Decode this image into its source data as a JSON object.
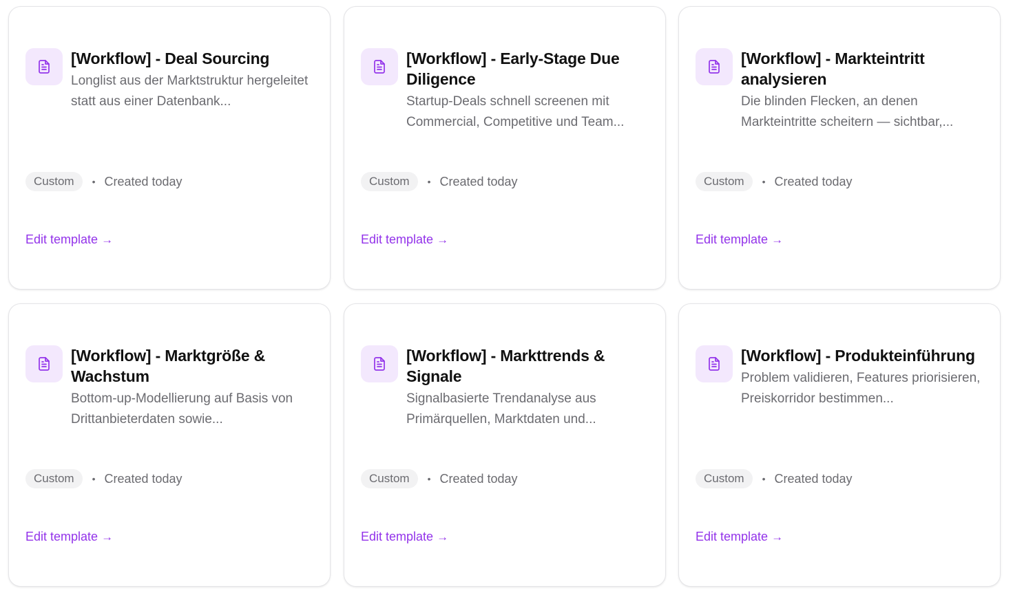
{
  "colors": {
    "accent": "#9333ea",
    "icon_bg": "#f3e8fd",
    "badge_bg": "#f2f2f3",
    "text_muted": "#6b6b70"
  },
  "cards": [
    {
      "icon": "document-icon",
      "title": "[Workflow] - Deal Sourcing",
      "description": "Longlist aus der Marktstruktur hergeleitet statt aus einer Datenbank...",
      "badge": "Custom",
      "separator": "•",
      "created": "Created today",
      "link_label": "Edit template",
      "link_arrow": "→"
    },
    {
      "icon": "document-icon",
      "title": "[Workflow] - Early-Stage Due Diligence",
      "description": "Startup-Deals schnell screenen mit Commercial, Competitive und Team...",
      "badge": "Custom",
      "separator": "•",
      "created": "Created today",
      "link_label": "Edit template",
      "link_arrow": "→"
    },
    {
      "icon": "document-icon",
      "title": "[Workflow] - Markteintritt analysieren",
      "description": "Die blinden Flecken, an denen Markteintritte scheitern — sichtbar,...",
      "badge": "Custom",
      "separator": "•",
      "created": "Created today",
      "link_label": "Edit template",
      "link_arrow": "→"
    },
    {
      "icon": "document-icon",
      "title": "[Workflow] - Marktgröße & Wachstum",
      "description": "Bottom-up-Modellierung auf Basis von Drittanbieterdaten sowie...",
      "badge": "Custom",
      "separator": "•",
      "created": "Created today",
      "link_label": "Edit template",
      "link_arrow": "→"
    },
    {
      "icon": "document-icon",
      "title": "[Workflow] - Markttrends & Signale",
      "description": "Signalbasierte Trendanalyse aus Primärquellen, Marktdaten und...",
      "badge": "Custom",
      "separator": "•",
      "created": "Created today",
      "link_label": "Edit template",
      "link_arrow": "→"
    },
    {
      "icon": "document-icon",
      "title": "[Workflow] - Produkteinführung",
      "description": "Problem validieren, Features priorisieren, Preiskorridor bestimmen...",
      "badge": "Custom",
      "separator": "•",
      "created": "Created today",
      "link_label": "Edit template",
      "link_arrow": "→"
    }
  ]
}
